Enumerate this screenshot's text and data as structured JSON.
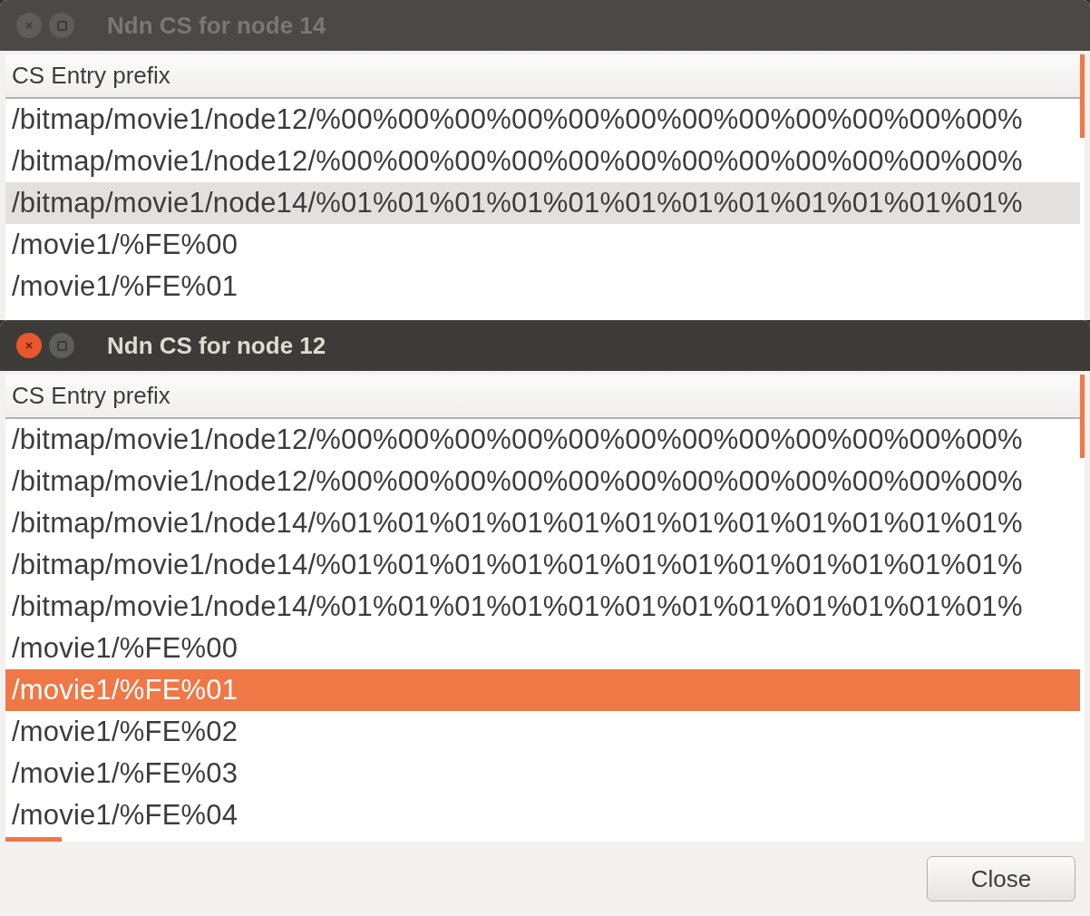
{
  "windows": [
    {
      "title": "Ndn CS for node 14",
      "active": false,
      "column": "CS Entry prefix",
      "rows": [
        {
          "text": "/bitmap/movie1/node12/%00%00%00%00%00%00%00%00%00%00%00%00%",
          "selected": false
        },
        {
          "text": "/bitmap/movie1/node12/%00%00%00%00%00%00%00%00%00%00%00%00%",
          "selected": false
        },
        {
          "text": "/bitmap/movie1/node14/%01%01%01%01%01%01%01%01%01%01%01%01%",
          "selected": true
        },
        {
          "text": "/movie1/%FE%00",
          "selected": false
        },
        {
          "text": "/movie1/%FE%01",
          "selected": false
        }
      ]
    },
    {
      "title": "Ndn CS for node 12",
      "active": true,
      "column": "CS Entry prefix",
      "rows": [
        {
          "text": "/bitmap/movie1/node12/%00%00%00%00%00%00%00%00%00%00%00%00%",
          "selected": false
        },
        {
          "text": "/bitmap/movie1/node12/%00%00%00%00%00%00%00%00%00%00%00%00%",
          "selected": false
        },
        {
          "text": "/bitmap/movie1/node14/%01%01%01%01%01%01%01%01%01%01%01%01%",
          "selected": false
        },
        {
          "text": "/bitmap/movie1/node14/%01%01%01%01%01%01%01%01%01%01%01%01%",
          "selected": false
        },
        {
          "text": "/bitmap/movie1/node14/%01%01%01%01%01%01%01%01%01%01%01%01%",
          "selected": false
        },
        {
          "text": "/movie1/%FE%00",
          "selected": false
        },
        {
          "text": "/movie1/%FE%01",
          "selected": true
        },
        {
          "text": "/movie1/%FE%02",
          "selected": false
        },
        {
          "text": "/movie1/%FE%03",
          "selected": false
        },
        {
          "text": "/movie1/%FE%04",
          "selected": false
        }
      ],
      "button": "Close"
    }
  ]
}
